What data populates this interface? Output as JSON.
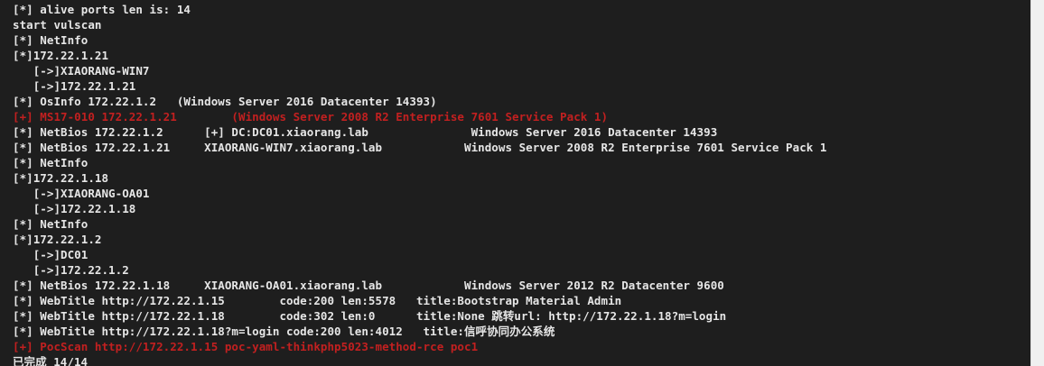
{
  "terminal": {
    "colors": {
      "background": "#1e1e1e",
      "text": "#e6e6e6",
      "vuln": "#c22020"
    },
    "lines": [
      {
        "text": "[*] alive ports len is: 14",
        "color": "normal"
      },
      {
        "text": "start vulscan",
        "color": "normal"
      },
      {
        "text": "[*] NetInfo",
        "color": "normal"
      },
      {
        "text": "[*]172.22.1.21",
        "color": "normal"
      },
      {
        "text": "   [->]XIAORANG-WIN7",
        "color": "normal"
      },
      {
        "text": "   [->]172.22.1.21",
        "color": "normal"
      },
      {
        "text": "[*] OsInfo 172.22.1.2   (Windows Server 2016 Datacenter 14393)",
        "color": "normal"
      },
      {
        "text": "[+] MS17-010 172.22.1.21        (Windows Server 2008 R2 Enterprise 7601 Service Pack 1)",
        "color": "red"
      },
      {
        "text": "[*] NetBios 172.22.1.2      [+] DC:DC01.xiaorang.lab               Windows Server 2016 Datacenter 14393",
        "color": "normal"
      },
      {
        "text": "[*] NetBios 172.22.1.21     XIAORANG-WIN7.xiaorang.lab            Windows Server 2008 R2 Enterprise 7601 Service Pack 1",
        "color": "normal"
      },
      {
        "text": "[*] NetInfo",
        "color": "normal"
      },
      {
        "text": "[*]172.22.1.18",
        "color": "normal"
      },
      {
        "text": "   [->]XIAORANG-OA01",
        "color": "normal"
      },
      {
        "text": "   [->]172.22.1.18",
        "color": "normal"
      },
      {
        "text": "[*] NetInfo",
        "color": "normal"
      },
      {
        "text": "[*]172.22.1.2",
        "color": "normal"
      },
      {
        "text": "   [->]DC01",
        "color": "normal"
      },
      {
        "text": "   [->]172.22.1.2",
        "color": "normal"
      },
      {
        "text": "[*] NetBios 172.22.1.18     XIAORANG-OA01.xiaorang.lab            Windows Server 2012 R2 Datacenter 9600",
        "color": "normal"
      },
      {
        "text": "[*] WebTitle http://172.22.1.15        code:200 len:5578   title:Bootstrap Material Admin",
        "color": "normal"
      },
      {
        "text": "[*] WebTitle http://172.22.1.18        code:302 len:0      title:None 跳转url: http://172.22.1.18?m=login",
        "color": "normal"
      },
      {
        "text": "[*] WebTitle http://172.22.1.18?m=login code:200 len:4012   title:信呼协同办公系统",
        "color": "normal"
      },
      {
        "text": "[+] PocScan http://172.22.1.15 poc-yaml-thinkphp5023-method-rce poc1",
        "color": "red"
      },
      {
        "text": "已完成 14/14",
        "color": "normal"
      }
    ]
  }
}
